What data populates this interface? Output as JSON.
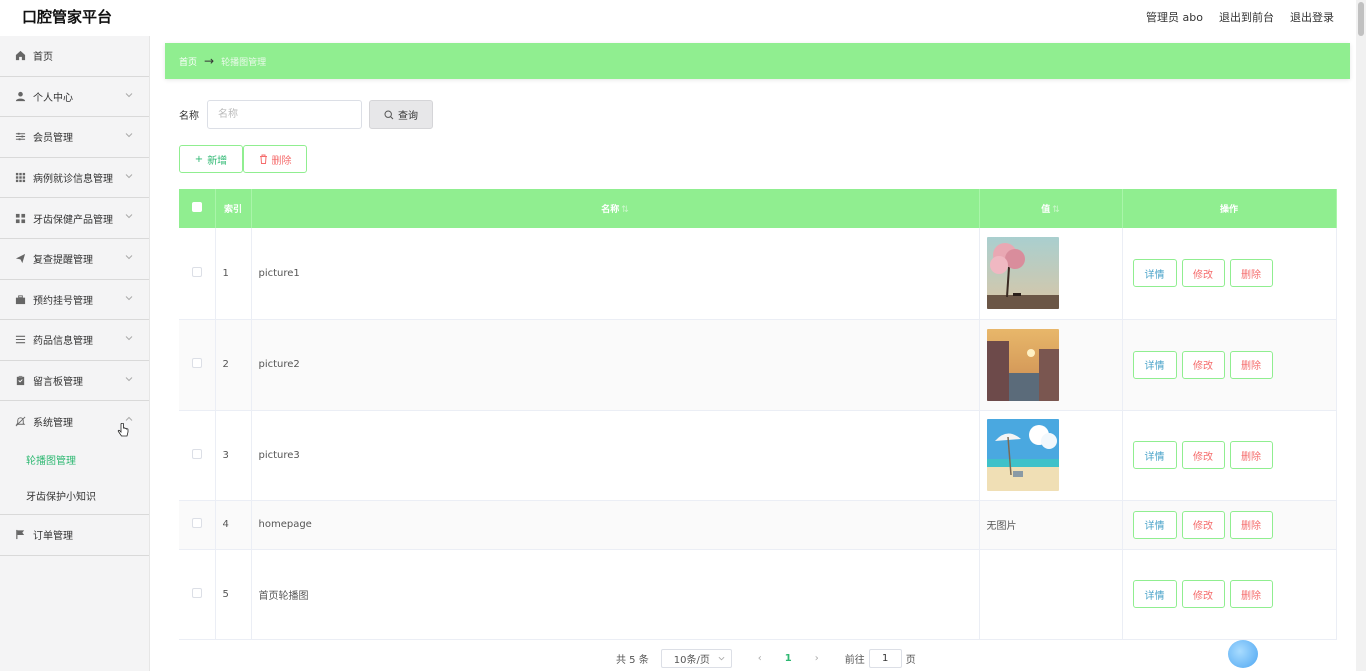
{
  "header": {
    "title": "口腔管家平台",
    "admin": "管理员 abo",
    "to_front": "退出到前台",
    "logout": "退出登录"
  },
  "sidebar": {
    "items": [
      {
        "label": "首页",
        "icon": "home-icon"
      },
      {
        "label": "个人中心",
        "icon": "user-icon"
      },
      {
        "label": "会员管理",
        "icon": "sliders-icon"
      },
      {
        "label": "病例就诊信息管理",
        "icon": "grid-icon"
      },
      {
        "label": "牙齿保健产品管理",
        "icon": "apps-icon"
      },
      {
        "label": "复查提醒管理",
        "icon": "send-icon"
      },
      {
        "label": "预约挂号管理",
        "icon": "briefcase-icon"
      },
      {
        "label": "药品信息管理",
        "icon": "list-icon"
      },
      {
        "label": "留言板管理",
        "icon": "clipboard-icon"
      },
      {
        "label": "系统管理",
        "icon": "bell-off-icon"
      }
    ],
    "sub_items": [
      {
        "label": "轮播图管理",
        "active": true
      },
      {
        "label": "牙齿保护小知识",
        "active": false
      }
    ],
    "last_item": {
      "label": "订单管理",
      "icon": "flag-icon"
    }
  },
  "breadcrumb": {
    "home": "首页",
    "arrow": "→",
    "current": "轮播图管理"
  },
  "search": {
    "label": "名称",
    "placeholder": "名称",
    "query_button": "查询"
  },
  "actions": {
    "add": "新增",
    "delete": "删除"
  },
  "table": {
    "headers": {
      "index": "索引",
      "name": "名称",
      "value": "值",
      "ops": "操作"
    },
    "rows": [
      {
        "index": "1",
        "name": "picture1",
        "value_text": "",
        "image": "tree-bench"
      },
      {
        "index": "2",
        "name": "picture2",
        "value_text": "",
        "image": "canal-town"
      },
      {
        "index": "3",
        "name": "picture3",
        "value_text": "",
        "image": "beach-umbrella"
      },
      {
        "index": "4",
        "name": "homepage",
        "value_text": "无图片",
        "image": ""
      },
      {
        "index": "5",
        "name": "首页轮播图",
        "value_text": "",
        "image": ""
      }
    ],
    "op_labels": {
      "detail": "详情",
      "edit": "修改",
      "remove": "删除"
    }
  },
  "pagination": {
    "total": "共 5 条",
    "page_size": "10条/页",
    "current_page": "1",
    "goto_label": "前往",
    "goto_value": "1",
    "page_suffix": "页"
  },
  "colors": {
    "accent_green": "#90ee90",
    "active_text": "#2eb872",
    "danger": "#f56c6c",
    "info": "#4aa3c9"
  }
}
